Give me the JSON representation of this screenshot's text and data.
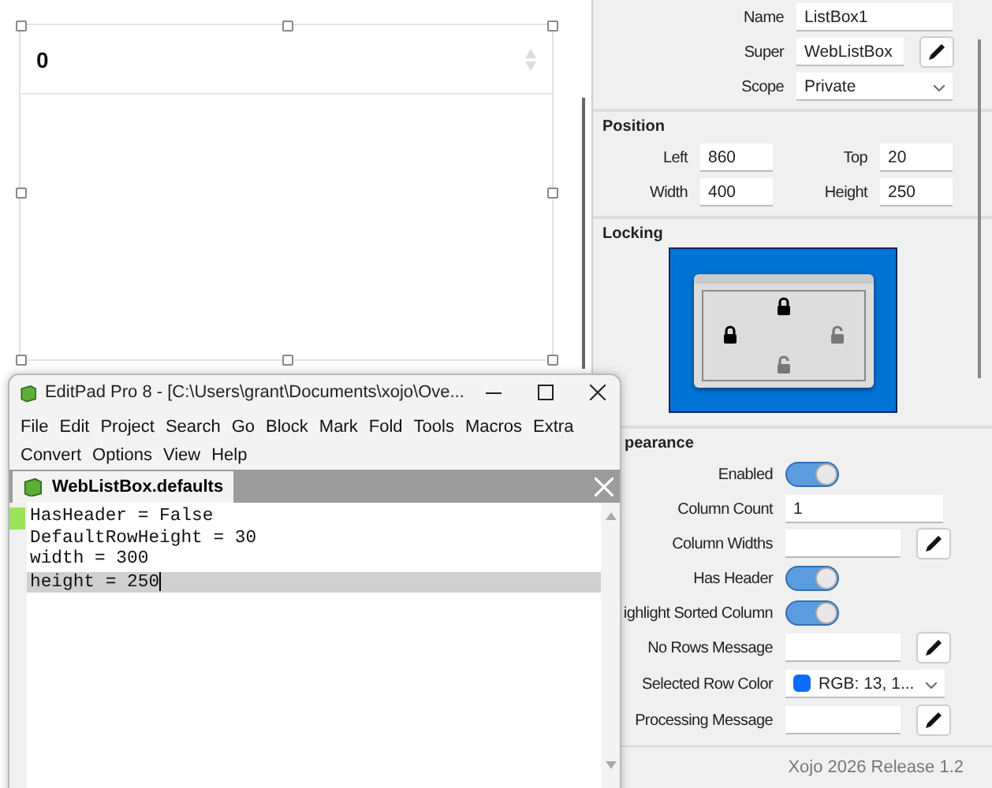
{
  "canvas": {
    "listbox": {
      "header": "0"
    }
  },
  "inspector": {
    "identity": [
      {
        "kind": "text",
        "label": "Name",
        "value": "ListBox1"
      },
      {
        "kind": "text-edit",
        "label": "Super",
        "value": "WebListBox"
      },
      {
        "kind": "dropdown",
        "label": "Scope",
        "value": "Private"
      }
    ],
    "position": {
      "title": "Position",
      "fields": [
        {
          "label": "Left",
          "value": "860"
        },
        {
          "label": "Top",
          "value": "20"
        },
        {
          "label": "Width",
          "value": "400"
        },
        {
          "label": "Height",
          "value": "250"
        }
      ]
    },
    "locking": {
      "title": "Locking",
      "top": true,
      "left": true,
      "right": false,
      "bottom": false
    },
    "appearance": {
      "title": "pearance",
      "rows": [
        {
          "kind": "toggle",
          "label": "Enabled",
          "on": true
        },
        {
          "kind": "text",
          "label": "Column Count",
          "value": "1"
        },
        {
          "kind": "text-edit",
          "label": "Column Widths"
        },
        {
          "kind": "toggle",
          "label": "Has Header",
          "on": true
        },
        {
          "kind": "toggle",
          "label": "ighlight Sorted Column",
          "on": true
        },
        {
          "kind": "text-edit",
          "label": "No Rows Message"
        },
        {
          "kind": "color",
          "label": "Selected Row Color",
          "value": "RGB: 13, 1...",
          "color": "#0d6efd"
        },
        {
          "kind": "text-edit",
          "label": "Processing Message"
        }
      ]
    }
  },
  "status_bar": "Xojo 2026 Release 1.2",
  "editor": {
    "title": "EditPad Pro 8 - [C:\\Users\\grant\\Documents\\xojo\\Ove...",
    "menu": [
      "File",
      "Edit",
      "Project",
      "Search",
      "Go",
      "Block",
      "Mark",
      "Fold",
      "Tools",
      "Macros",
      "Extra",
      "Convert",
      "Options",
      "View",
      "Help"
    ],
    "tab": {
      "label": "WebListBox.defaults",
      "selected": true
    },
    "lines": [
      {
        "text": "HasHeader = False",
        "marked": true,
        "selected": false
      },
      {
        "text": "DefaultRowHeight = 30",
        "marked": false,
        "selected": false
      },
      {
        "text": "width = 300",
        "marked": false,
        "selected": false
      },
      {
        "text": "height = 250",
        "marked": false,
        "selected": true
      }
    ]
  }
}
